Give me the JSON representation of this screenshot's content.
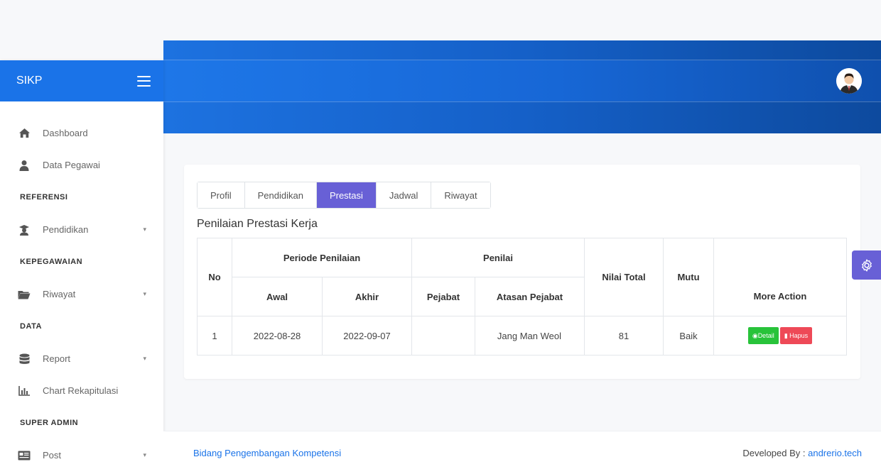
{
  "brand": {
    "name": "SIKP"
  },
  "sidebar": {
    "items": [
      {
        "type": "item",
        "label": "Dashboard",
        "icon": "home-icon"
      },
      {
        "type": "item",
        "label": "Data Pegawai",
        "icon": "user-icon"
      },
      {
        "type": "head",
        "label": "REFERENSI"
      },
      {
        "type": "item",
        "label": "Pendidikan",
        "icon": "graduate-icon",
        "caret": true
      },
      {
        "type": "head",
        "label": "KEPEGAWAIAN"
      },
      {
        "type": "item",
        "label": "Riwayat",
        "icon": "folder-icon",
        "caret": true
      },
      {
        "type": "head",
        "label": "DATA"
      },
      {
        "type": "item",
        "label": "Report",
        "icon": "database-icon",
        "caret": true
      },
      {
        "type": "item",
        "label": "Chart Rekapitulasi",
        "icon": "chart-icon"
      },
      {
        "type": "head",
        "label": "SUPER ADMIN"
      },
      {
        "type": "item",
        "label": "Post",
        "icon": "newspaper-icon",
        "caret": true
      }
    ]
  },
  "tabs": [
    "Profil",
    "Pendidikan",
    "Prestasi",
    "Jadwal",
    "Riwayat"
  ],
  "active_tab": "Prestasi",
  "section_title": "Penilaian Prestasi Kerja",
  "table": {
    "h_no": "No",
    "h_periode": "Periode Penilaian",
    "h_penilai": "Penilai",
    "h_nilai_total": "Nilai Total",
    "h_mutu": "Mutu",
    "h_more_action": "More Action",
    "h_awal": "Awal",
    "h_akhir": "Akhir",
    "h_pejabat": "Pejabat",
    "h_atasan": "Atasan Pejabat",
    "rows": [
      {
        "no": "1",
        "awal": "2022-08-28",
        "akhir": "2022-09-07",
        "pejabat": "",
        "atasan": "Jang Man Weol",
        "nilai_total": "81",
        "mutu": "Baik"
      }
    ],
    "detail_label": "Detail",
    "hapus_label": "Hapus"
  },
  "footer": {
    "left": "Bidang Pengembangan Kompetensi",
    "right_prefix": "Developed By : ",
    "right_link": "andrerio.tech"
  },
  "colors": {
    "primary": "#1a73e8",
    "accent": "#6860d6",
    "success": "#28c33a",
    "danger": "#ee4957"
  }
}
